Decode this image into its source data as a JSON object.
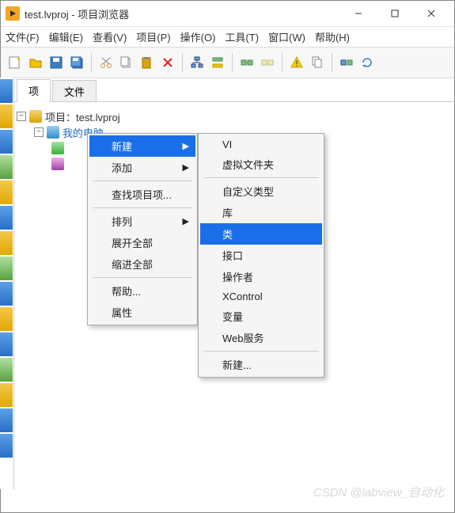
{
  "title": "test.lvproj - 项目浏览器",
  "menubar": [
    "文件(F)",
    "编辑(E)",
    "查看(V)",
    "项目(P)",
    "操作(O)",
    "工具(T)",
    "窗口(W)",
    "帮助(H)"
  ],
  "tabs": {
    "items_tab": "项",
    "files_tab": "文件"
  },
  "tree": {
    "project_label": "项目：test.lvproj",
    "my_computer": "我的电脑"
  },
  "context_menu1": {
    "new": "新建",
    "add": "添加",
    "find": "查找项目项...",
    "arrange": "排列",
    "expand": "展开全部",
    "collapse": "缩进全部",
    "help": "帮助...",
    "props": "属性"
  },
  "context_menu2": {
    "vi": "VI",
    "vfolder": "虚拟文件夹",
    "customtype": "自定义类型",
    "lib": "库",
    "class": "类",
    "interface": "接口",
    "actor": "操作者",
    "xcontrol": "XControl",
    "variable": "变量",
    "webservice": "Web服务",
    "new_more": "新建..."
  },
  "watermark": "CSDN @labview_自动化"
}
